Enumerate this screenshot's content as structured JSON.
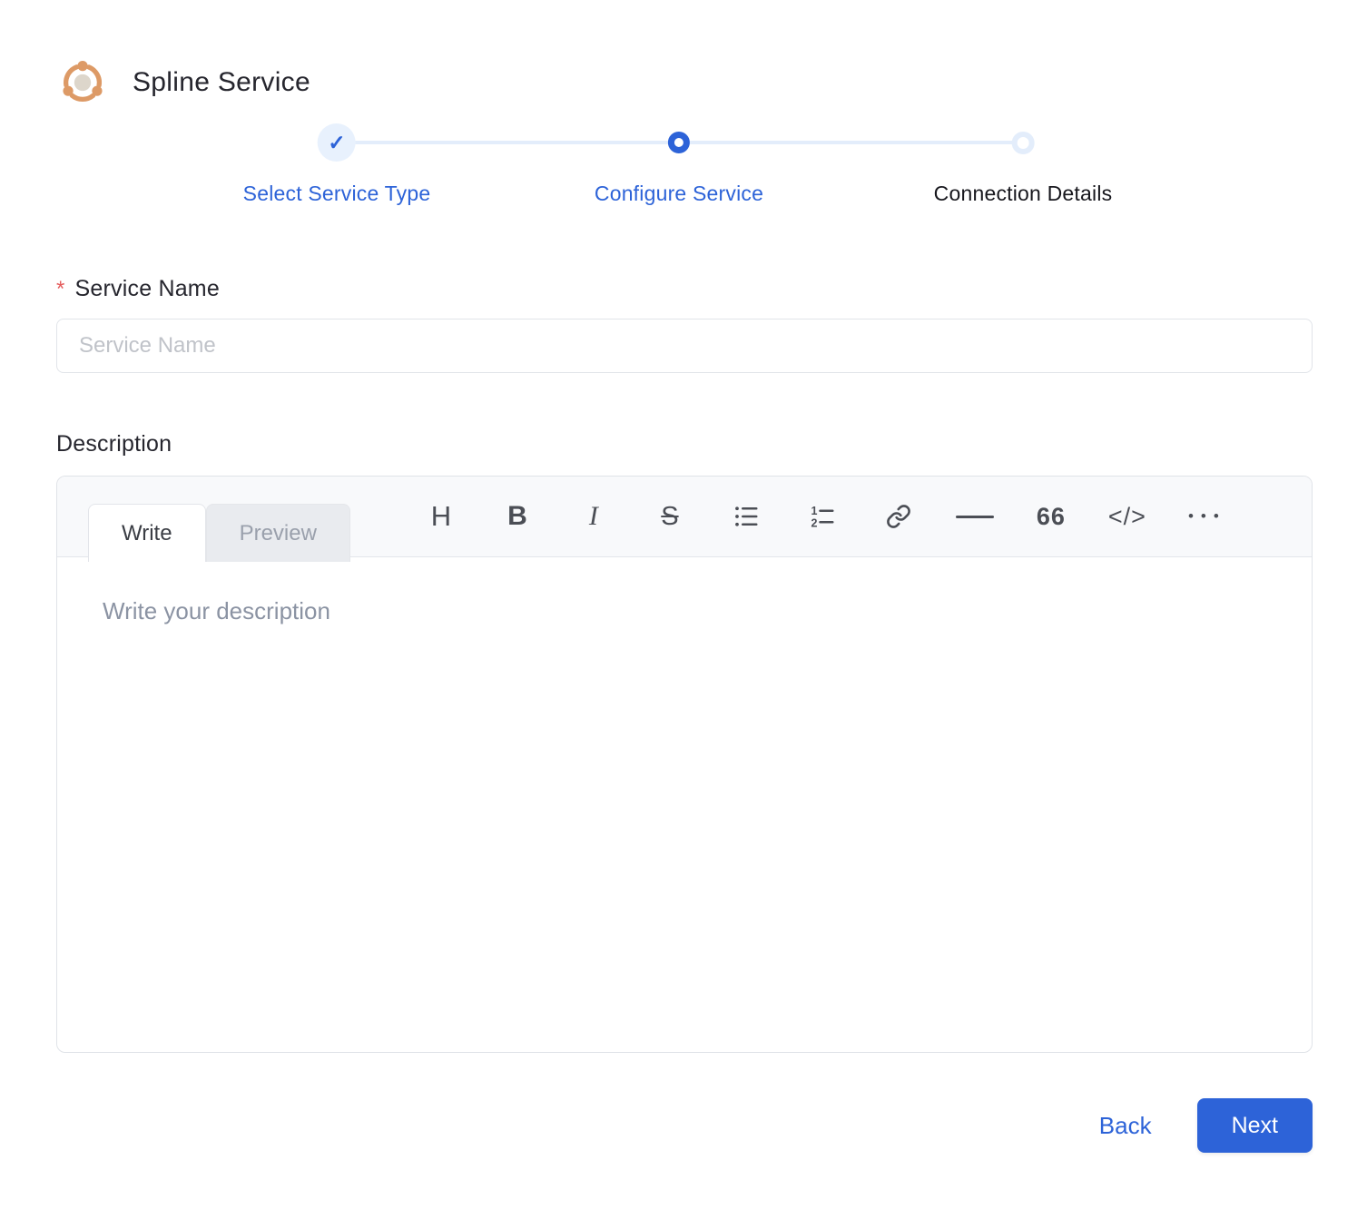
{
  "header": {
    "title": "Spline Service",
    "logo_icon": "cluster-icon"
  },
  "stepper": {
    "steps": [
      {
        "label": "Select Service Type",
        "state": "completed",
        "check_glyph": "✓"
      },
      {
        "label": "Configure Service",
        "state": "active"
      },
      {
        "label": "Connection Details",
        "state": "upcoming"
      }
    ]
  },
  "form": {
    "service_name": {
      "label": "Service Name",
      "required_marker": "*",
      "placeholder": "Service Name",
      "value": ""
    },
    "description": {
      "label": "Description",
      "editor": {
        "tabs": [
          {
            "label": "Write",
            "active": true
          },
          {
            "label": "Preview",
            "active": false
          }
        ],
        "toolbar": [
          {
            "name": "heading",
            "glyph": "H"
          },
          {
            "name": "bold",
            "glyph": "B"
          },
          {
            "name": "italic",
            "glyph": "I"
          },
          {
            "name": "strikethrough",
            "glyph": "S"
          },
          {
            "name": "bullet-list"
          },
          {
            "name": "numbered-list"
          },
          {
            "name": "link"
          },
          {
            "name": "horizontal-rule"
          },
          {
            "name": "quote",
            "glyph": "66"
          },
          {
            "name": "code",
            "glyph": "</>"
          },
          {
            "name": "more",
            "glyph": "•••"
          }
        ],
        "placeholder": "Write your description",
        "value": ""
      }
    }
  },
  "footer": {
    "back_label": "Back",
    "next_label": "Next"
  },
  "colors": {
    "accent_blue": "#2d63d8",
    "accent_light": "#e8f1fd",
    "connector_blue": "#e3edfb",
    "brand_orange": "#dd9a66",
    "required_red": "#e45c5c"
  }
}
